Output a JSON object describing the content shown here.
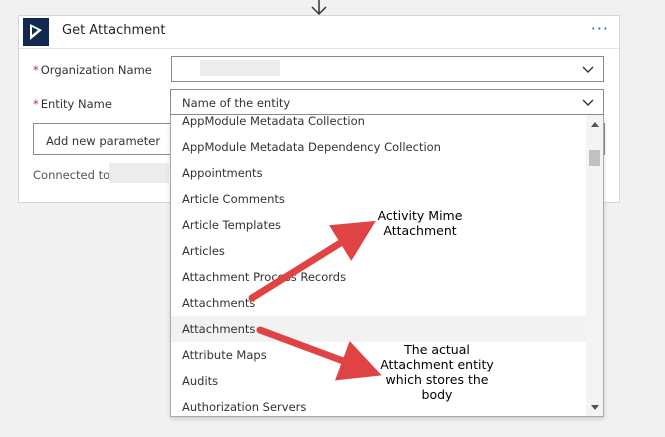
{
  "card": {
    "title": "Get Attachment",
    "more_label": "···"
  },
  "fields": {
    "required_mark": "*",
    "organization_label": "Organization Name",
    "entity_label": "Entity Name",
    "entity_placeholder": "Name of the entity"
  },
  "add_parameter_label": "Add new parameter",
  "connected_label": "Connected to",
  "dropdown": {
    "items": [
      {
        "label": "AppModule Metadata Collection"
      },
      {
        "label": "AppModule Metadata Dependency Collection"
      },
      {
        "label": "Appointments"
      },
      {
        "label": "Article Comments"
      },
      {
        "label": "Article Templates"
      },
      {
        "label": "Articles"
      },
      {
        "label": "Attachment Process Records"
      },
      {
        "label": "Attachments"
      },
      {
        "label": "Attachments"
      },
      {
        "label": "Attribute Maps"
      },
      {
        "label": "Audits"
      },
      {
        "label": "Authorization Servers"
      }
    ]
  },
  "annotations": {
    "callout_1_line1": "Activity Mime",
    "callout_1_line2": "Attachment",
    "callout_2_line1": "The actual",
    "callout_2_line2": "Attachment entity",
    "callout_2_line3": "which stores the",
    "callout_2_line4": "body",
    "arrow_color": "#e04343"
  },
  "colors": {
    "accent": "#2b66c5",
    "required": "#c4262e",
    "logo_bg": "#0f2a4d"
  }
}
